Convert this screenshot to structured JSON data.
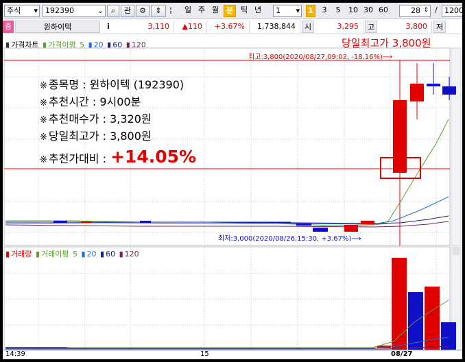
{
  "toolbar": {
    "market_select": "주식",
    "code_input": "192390",
    "btn_search": "⌕",
    "btn_link": "관",
    "period_tabs": [
      "일",
      "주",
      "월",
      "분",
      "틱",
      "년"
    ],
    "active_period": "분",
    "interval_input": "1",
    "interval_buttons": [
      "1",
      "3",
      "5",
      "10",
      "30",
      "60"
    ],
    "active_interval": "1",
    "count_input": "28",
    "slash": "/",
    "total_input": "1200"
  },
  "quote": {
    "badge": "증",
    "name": "윈하이텍",
    "info_btn": "i",
    "price": "3,110",
    "change": "▲110",
    "rate": "+3.67%",
    "volume": "1,738,844",
    "open_label": "시",
    "open": "3,295",
    "high_label": "고",
    "high": "3,800",
    "low_label": "저"
  },
  "price_panel": {
    "legend_title": "가격차트",
    "legend_ma": "가격이평",
    "legend_periods": [
      "5",
      "20",
      "60",
      "120"
    ],
    "day_high_caption": "당일최고가 3,800원",
    "high_marker": "최고:3,800(2020/08/27,09:02, -18.16%)⟶",
    "low_marker": "최저:3,000(2020/08/26,15:30, +3.67%)⟶"
  },
  "info_box": {
    "mark": "※",
    "lines": [
      "종목명 : 윈하이텍 (192390)",
      "추천시간 : 9시00분",
      "추천매수가 : 3,320원",
      "당일최고가 : 3,800원"
    ],
    "ratio_label": "추천가대비 :",
    "ratio_value": "+14.05%"
  },
  "volume_panel": {
    "legend_title": "거래량",
    "legend_ma": "거래이평",
    "legend_periods": [
      "5",
      "20",
      "60",
      "120"
    ]
  },
  "x_axis": {
    "labels": [
      "14:39",
      "15",
      "08/27"
    ]
  },
  "colors": {
    "up": "#e00000",
    "down": "#1010c8",
    "ma5": "#5aa02c",
    "ma20": "#1e6fd0",
    "ma60": "#1a1a8c",
    "ma120": "#7a1f5a"
  }
}
